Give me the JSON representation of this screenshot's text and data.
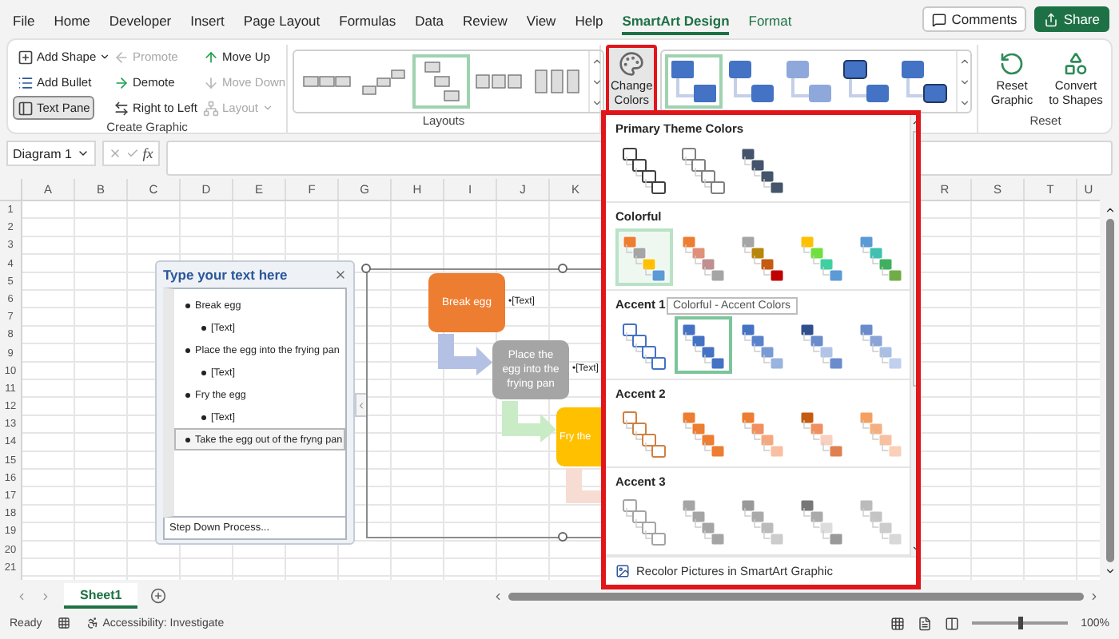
{
  "menu_tabs": [
    {
      "label": "File",
      "selected": false,
      "contextual": false
    },
    {
      "label": "Home",
      "selected": false,
      "contextual": false
    },
    {
      "label": "Developer",
      "selected": false,
      "contextual": false
    },
    {
      "label": "Insert",
      "selected": false,
      "contextual": false
    },
    {
      "label": "Page Layout",
      "selected": false,
      "contextual": false
    },
    {
      "label": "Formulas",
      "selected": false,
      "contextual": false
    },
    {
      "label": "Data",
      "selected": false,
      "contextual": false
    },
    {
      "label": "Review",
      "selected": false,
      "contextual": false
    },
    {
      "label": "View",
      "selected": false,
      "contextual": false
    },
    {
      "label": "Help",
      "selected": false,
      "contextual": false
    },
    {
      "label": "SmartArt Design",
      "selected": true,
      "contextual": true
    },
    {
      "label": "Format",
      "selected": false,
      "contextual": true
    }
  ],
  "header_buttons": {
    "comments": "Comments",
    "share": "Share"
  },
  "create_graphic": {
    "label": "Create Graphic",
    "buttons": [
      {
        "label": "Add Shape",
        "dropdown": true,
        "disabled": false,
        "pressed": false
      },
      {
        "label": "Add Bullet",
        "dropdown": false,
        "disabled": false,
        "pressed": false
      },
      {
        "label": "Text Pane",
        "dropdown": false,
        "disabled": false,
        "pressed": true
      },
      {
        "label": "Promote",
        "dropdown": false,
        "disabled": true,
        "pressed": false
      },
      {
        "label": "Demote",
        "dropdown": false,
        "disabled": false,
        "pressed": false
      },
      {
        "label": "Right to Left",
        "dropdown": false,
        "disabled": false,
        "pressed": false
      },
      {
        "label": "Move Up",
        "dropdown": false,
        "disabled": false,
        "pressed": false
      },
      {
        "label": "Move Down",
        "dropdown": false,
        "disabled": true,
        "pressed": false
      },
      {
        "label": "Layout",
        "dropdown": true,
        "disabled": true,
        "pressed": false
      }
    ]
  },
  "layouts": {
    "label": "Layouts",
    "options": [
      {
        "selected": false
      },
      {
        "selected": false
      },
      {
        "selected": true
      },
      {
        "selected": false
      },
      {
        "selected": false
      }
    ]
  },
  "change_colors": {
    "label": "Change Colors",
    "open": true
  },
  "style_options": [
    {
      "selected": true
    },
    {
      "selected": false
    },
    {
      "selected": false
    },
    {
      "selected": false
    },
    {
      "selected": false
    }
  ],
  "reset": {
    "label": "Reset",
    "buttons": [
      "Reset Graphic",
      "Convert to Shapes"
    ]
  },
  "formula_bar": {
    "name_box": "Diagram 1",
    "function_label": "fx"
  },
  "sheet": {
    "columns": [
      "A",
      "B",
      "C",
      "D",
      "E",
      "F",
      "G",
      "H",
      "I",
      "J",
      "K"
    ],
    "columns_right": [
      "R",
      "S",
      "T",
      "U"
    ],
    "rows": [
      "1",
      "2",
      "3",
      "4",
      "5",
      "6",
      "7",
      "8",
      "9",
      "10",
      "11",
      "12",
      "13",
      "14",
      "15",
      "16",
      "17",
      "18",
      "19",
      "20",
      "21"
    ]
  },
  "text_pane": {
    "title": "Type your text here",
    "footer": "Step Down Process...",
    "items": [
      {
        "text": "Break egg",
        "selected": false,
        "children": [
          {
            "text": "[Text]",
            "selected": false
          }
        ]
      },
      {
        "text": "Place the egg into the frying pan",
        "selected": false,
        "children": [
          {
            "text": "[Text]",
            "selected": false
          }
        ]
      },
      {
        "text": "Fry the egg",
        "selected": false,
        "children": [
          {
            "text": "[Text]",
            "selected": false
          }
        ]
      },
      {
        "text": "Take the egg out of the fryng pan",
        "selected": true
      }
    ]
  },
  "smartart": {
    "steps": [
      {
        "text": "Break egg",
        "color": "#ed7d31",
        "note": "•[Text]"
      },
      {
        "text": "Place the egg into the frying pan",
        "color": "#a5a5a5",
        "note": "•[Text]"
      },
      {
        "text": "Fry the",
        "color": "#ffc000"
      }
    ]
  },
  "color_menu": {
    "sections": [
      {
        "title": "Primary Theme Colors",
        "options": [
          {
            "selected": false,
            "highlighted": false
          },
          {
            "selected": false,
            "highlighted": false
          },
          {
            "selected": false,
            "highlighted": false
          }
        ]
      },
      {
        "title": "Colorful",
        "options": [
          {
            "selected": true,
            "highlighted": false
          },
          {
            "selected": false,
            "highlighted": false
          },
          {
            "selected": false,
            "highlighted": false
          },
          {
            "selected": false,
            "highlighted": false
          },
          {
            "selected": false,
            "highlighted": false
          }
        ]
      },
      {
        "title": "Accent 1",
        "options": [
          {
            "selected": false,
            "highlighted": false
          },
          {
            "selected": false,
            "highlighted": true
          },
          {
            "selected": false,
            "highlighted": false
          },
          {
            "selected": false,
            "highlighted": false
          },
          {
            "selected": false,
            "highlighted": false
          }
        ]
      },
      {
        "title": "Accent 2",
        "options": [
          {
            "selected": false,
            "highlighted": false
          },
          {
            "selected": false,
            "highlighted": false
          },
          {
            "selected": false,
            "highlighted": false
          },
          {
            "selected": false,
            "highlighted": false
          },
          {
            "selected": false,
            "highlighted": false
          }
        ]
      },
      {
        "title": "Accent 3",
        "options": [
          {
            "selected": false,
            "highlighted": false
          },
          {
            "selected": false,
            "highlighted": false
          },
          {
            "selected": false,
            "highlighted": false
          },
          {
            "selected": false,
            "highlighted": false
          },
          {
            "selected": false,
            "highlighted": false
          }
        ]
      }
    ],
    "tooltip": "Colorful - Accent Colors",
    "footer": "Recolor Pictures in SmartArt Graphic"
  },
  "sheet_tabs": [
    {
      "label": "Sheet1",
      "selected": true
    }
  ],
  "status_bar": {
    "ready": "Ready",
    "accessibility": "Accessibility: Investigate",
    "zoom": {
      "reading": "100%",
      "level": 0.5
    }
  }
}
